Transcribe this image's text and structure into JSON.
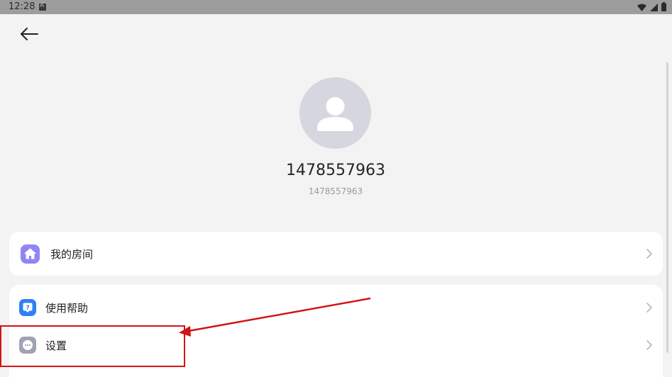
{
  "status_bar": {
    "time": "12:28",
    "notification_icon": "a-box-icon",
    "wifi_icon": "wifi-icon",
    "signal_icon": "cell-signal-icon",
    "battery_icon": "battery-icon"
  },
  "header": {
    "back_icon": "arrow-left-icon"
  },
  "profile": {
    "avatar_icon": "person-icon",
    "name": "1478557963",
    "id": "1478557963"
  },
  "menu": {
    "my_room": {
      "label": "我的房间",
      "icon": "home-icon",
      "icon_color": "#8f86f5"
    },
    "help": {
      "label": "使用帮助",
      "icon": "question-icon",
      "icon_color": "#2f7ff5"
    },
    "settings": {
      "label": "设置",
      "icon": "more-dots-icon",
      "icon_color": "#9fa3b1"
    }
  },
  "annotation": {
    "color": "#d21414"
  }
}
